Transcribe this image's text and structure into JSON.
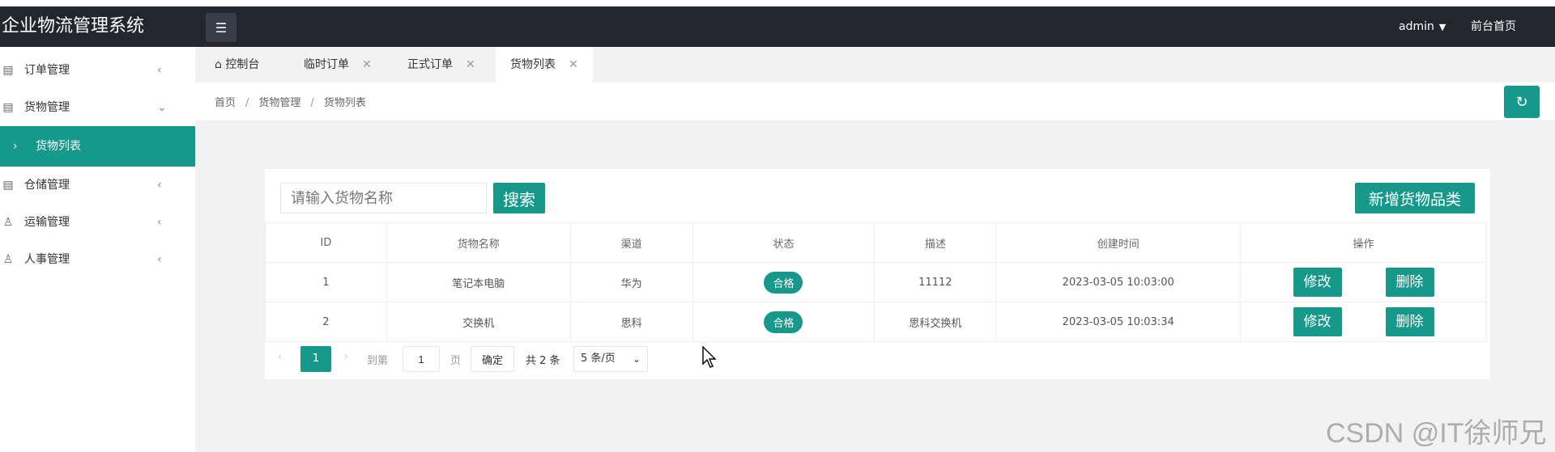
{
  "app": {
    "title": "企业物流管理系统"
  },
  "header": {
    "user": "admin",
    "front_link": "前台首页"
  },
  "sidebar": {
    "items": [
      {
        "label": "订单管理",
        "arrow": "‹"
      },
      {
        "label": "货物管理",
        "arrow": "⌄"
      },
      {
        "label": "货物列表",
        "chevron": "›"
      },
      {
        "label": "仓储管理",
        "arrow": "‹"
      },
      {
        "label": "运输管理",
        "arrow": "‹"
      },
      {
        "label": "人事管理",
        "arrow": "‹"
      }
    ]
  },
  "tabs": [
    {
      "label": "控制台"
    },
    {
      "label": "临时订单"
    },
    {
      "label": "正式订单"
    },
    {
      "label": "货物列表"
    }
  ],
  "breadcrumb": {
    "items": [
      "首页",
      "货物管理",
      "货物列表"
    ],
    "separator": "/"
  },
  "search": {
    "placeholder": "请输入货物名称",
    "button": "搜索"
  },
  "add_button": "新增货物品类",
  "table": {
    "headers": [
      "ID",
      "货物名称",
      "渠道",
      "状态",
      "描述",
      "创建时间",
      "操作"
    ],
    "rows": [
      {
        "id": "1",
        "name": "笔记本电脑",
        "channel": "华为",
        "status": "合格",
        "desc": "11112",
        "created": "2023-03-05 10:03:00",
        "edit": "修改",
        "delete": "删除"
      },
      {
        "id": "2",
        "name": "交换机",
        "channel": "思科",
        "status": "合格",
        "desc": "思科交换机",
        "created": "2023-03-05 10:03:34",
        "edit": "修改",
        "delete": "删除"
      }
    ]
  },
  "pagination": {
    "current": "1",
    "goto_label": "到第",
    "goto_value": "1",
    "page_label": "页",
    "confirm": "确定",
    "total": "共 2 条",
    "page_size": "5 条/页"
  },
  "watermark": "CSDN @IT徐师兄",
  "colors": {
    "accent": "#16998a",
    "topbar": "#23262e"
  }
}
